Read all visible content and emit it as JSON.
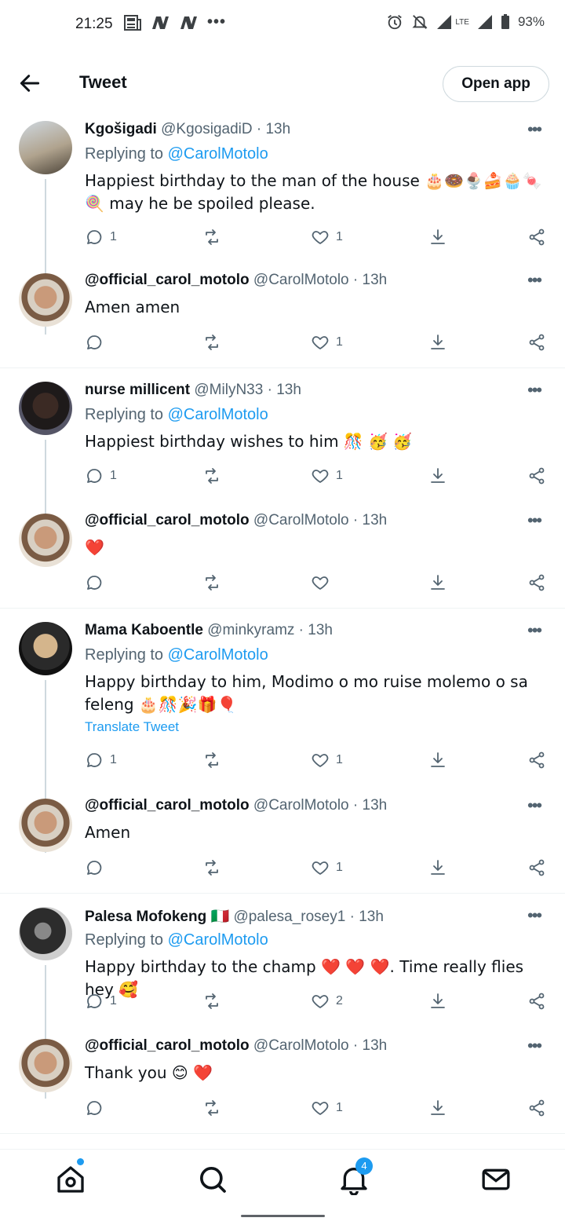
{
  "status_bar": {
    "time": "21:25",
    "battery": "93%",
    "network": "LTE",
    "notif_icons": [
      "news-icon",
      "n-icon",
      "n-icon",
      "more-dots"
    ]
  },
  "header": {
    "title": "Tweet",
    "open_app": "Open app"
  },
  "tweets": [
    {
      "name": "Kgošigadi",
      "handle": "@KgosigadiD",
      "time": "· 13h",
      "replying": "Replying to",
      "replying_handle": "@CarolMotolo",
      "text": "Happiest birthday to the man of the house 🎂🍩🍨🍰🧁🍬🍭 may he be spoiled please.",
      "replies": "1",
      "likes": "1"
    },
    {
      "name": "@official_carol_motolo",
      "handle": "@CarolMotolo",
      "time": "· 13h",
      "text": "Amen amen",
      "replies": "",
      "likes": "1"
    },
    {
      "name": "nurse millicent",
      "handle": "@MilyN33",
      "time": "· 13h",
      "replying": "Replying to",
      "replying_handle": "@CarolMotolo",
      "text": "Happiest birthday wishes to him 🎊 🥳 🥳",
      "replies": "1",
      "likes": "1"
    },
    {
      "name": "@official_carol_motolo",
      "handle": "@CarolMotolo",
      "time": "· 13h",
      "text": "❤️",
      "replies": "",
      "likes": ""
    },
    {
      "name": "Mama Kaboentle",
      "handle": "@minkyramz",
      "time": "· 13h",
      "replying": "Replying to",
      "replying_handle": "@CarolMotolo",
      "text": "Happy birthday to him, Modimo o mo ruise molemo o sa feleng 🎂🎊🎉🎁🎈",
      "translate": "Translate Tweet",
      "replies": "1",
      "likes": "1"
    },
    {
      "name": "@official_carol_motolo",
      "handle": "@CarolMotolo",
      "time": "· 13h",
      "text": "Amen",
      "replies": "",
      "likes": "1"
    },
    {
      "name": "Palesa Mofokeng 🇮🇹",
      "handle": "@palesa_rosey1",
      "time": "· 13h",
      "replying": "Replying to",
      "replying_handle": "@CarolMotolo",
      "text": "Happy birthday to the champ ❤️ ❤️ ❤️. Time really flies hey 🥰",
      "replies": "1",
      "likes": "2"
    },
    {
      "name": "@official_carol_motolo",
      "handle": "@CarolMotolo",
      "time": "· 13h",
      "text": "Thank you 😊 ❤️",
      "replies": "",
      "likes": "1"
    }
  ],
  "bottom_nav": {
    "notifications_badge": "4"
  },
  "colors": {
    "accent": "#1d9bf0",
    "text": "#0f1419",
    "muted": "#536471",
    "divider": "#eff3f4"
  }
}
